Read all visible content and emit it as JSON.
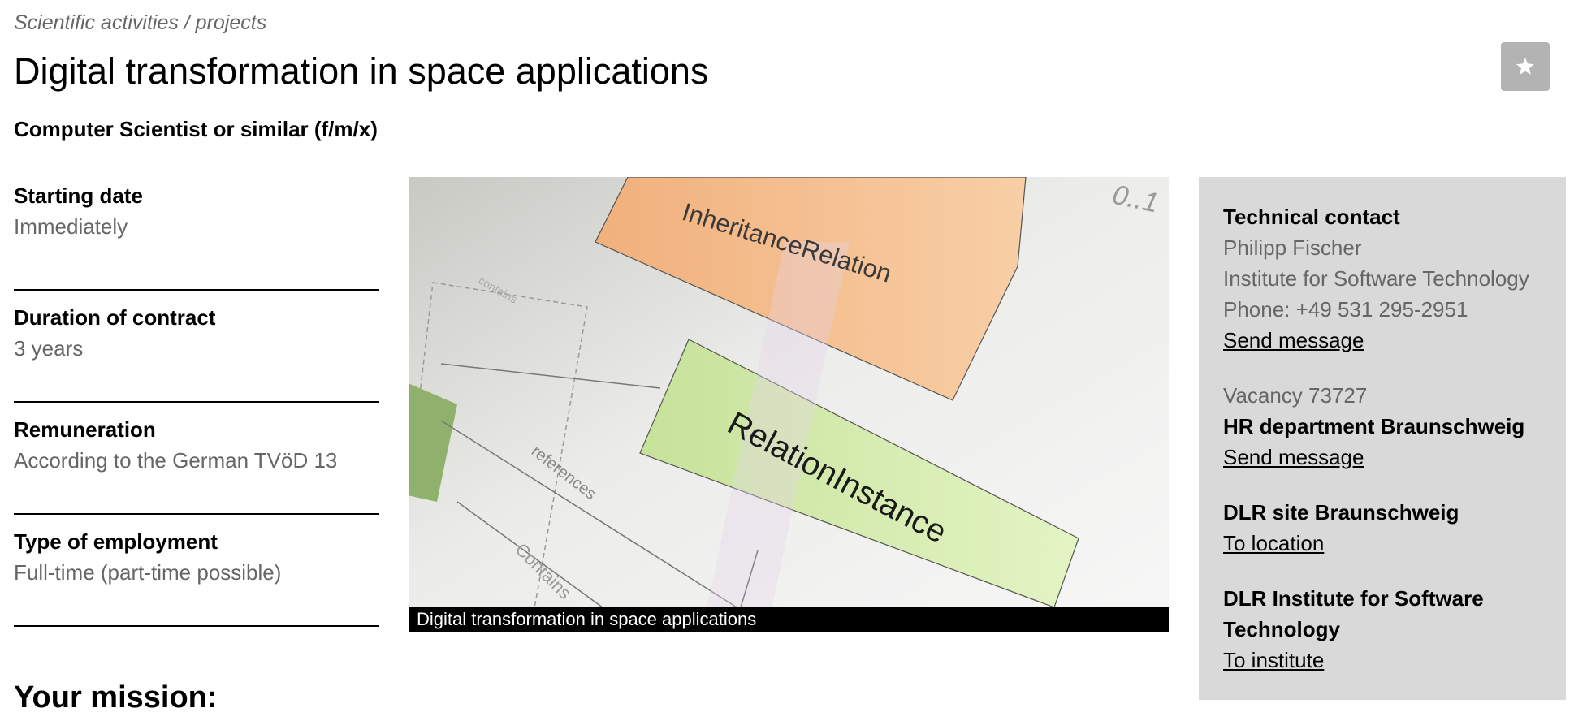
{
  "breadcrumb": "Scientific activities / projects",
  "title": "Digital transformation in space applications",
  "subtitle": "Computer Scientist or similar (f/m/x)",
  "facts": [
    {
      "label": "Starting date",
      "value": "Immediately"
    },
    {
      "label": "Duration of contract",
      "value": "3 years"
    },
    {
      "label": "Remuneration",
      "value": "According to the German TVöD 13"
    },
    {
      "label": "Type of employment",
      "value": "Full-time (part-time possible)"
    }
  ],
  "figure": {
    "caption": "Digital transformation in space applications",
    "diagram_labels": {
      "box1": "InheritanceRelation",
      "box2": "RelationInstance",
      "multiplicity": "0..1",
      "edge1": "references",
      "edge2": "Contains",
      "edge3": "contains"
    }
  },
  "sidebar": {
    "technical_contact": {
      "heading": "Technical contact",
      "name": "Philipp Fischer",
      "institute": "Institute for Software Technology",
      "phone": "Phone: +49 531 295-2951",
      "link": "Send message"
    },
    "hr": {
      "vacancy": "Vacancy 73727",
      "heading": "HR department Braunschweig",
      "link": "Send message"
    },
    "site": {
      "heading": "DLR site Braunschweig",
      "link": "To location"
    },
    "institute": {
      "heading": "DLR Institute for Software Technology",
      "link": "To institute"
    }
  },
  "mission_heading": "Your mission:",
  "colors": {
    "sidebar_bg": "#d9d9d9",
    "muted_text": "#666666",
    "favorite_button": "#b3b3b3"
  },
  "icons": {
    "favorite": "star-icon"
  }
}
